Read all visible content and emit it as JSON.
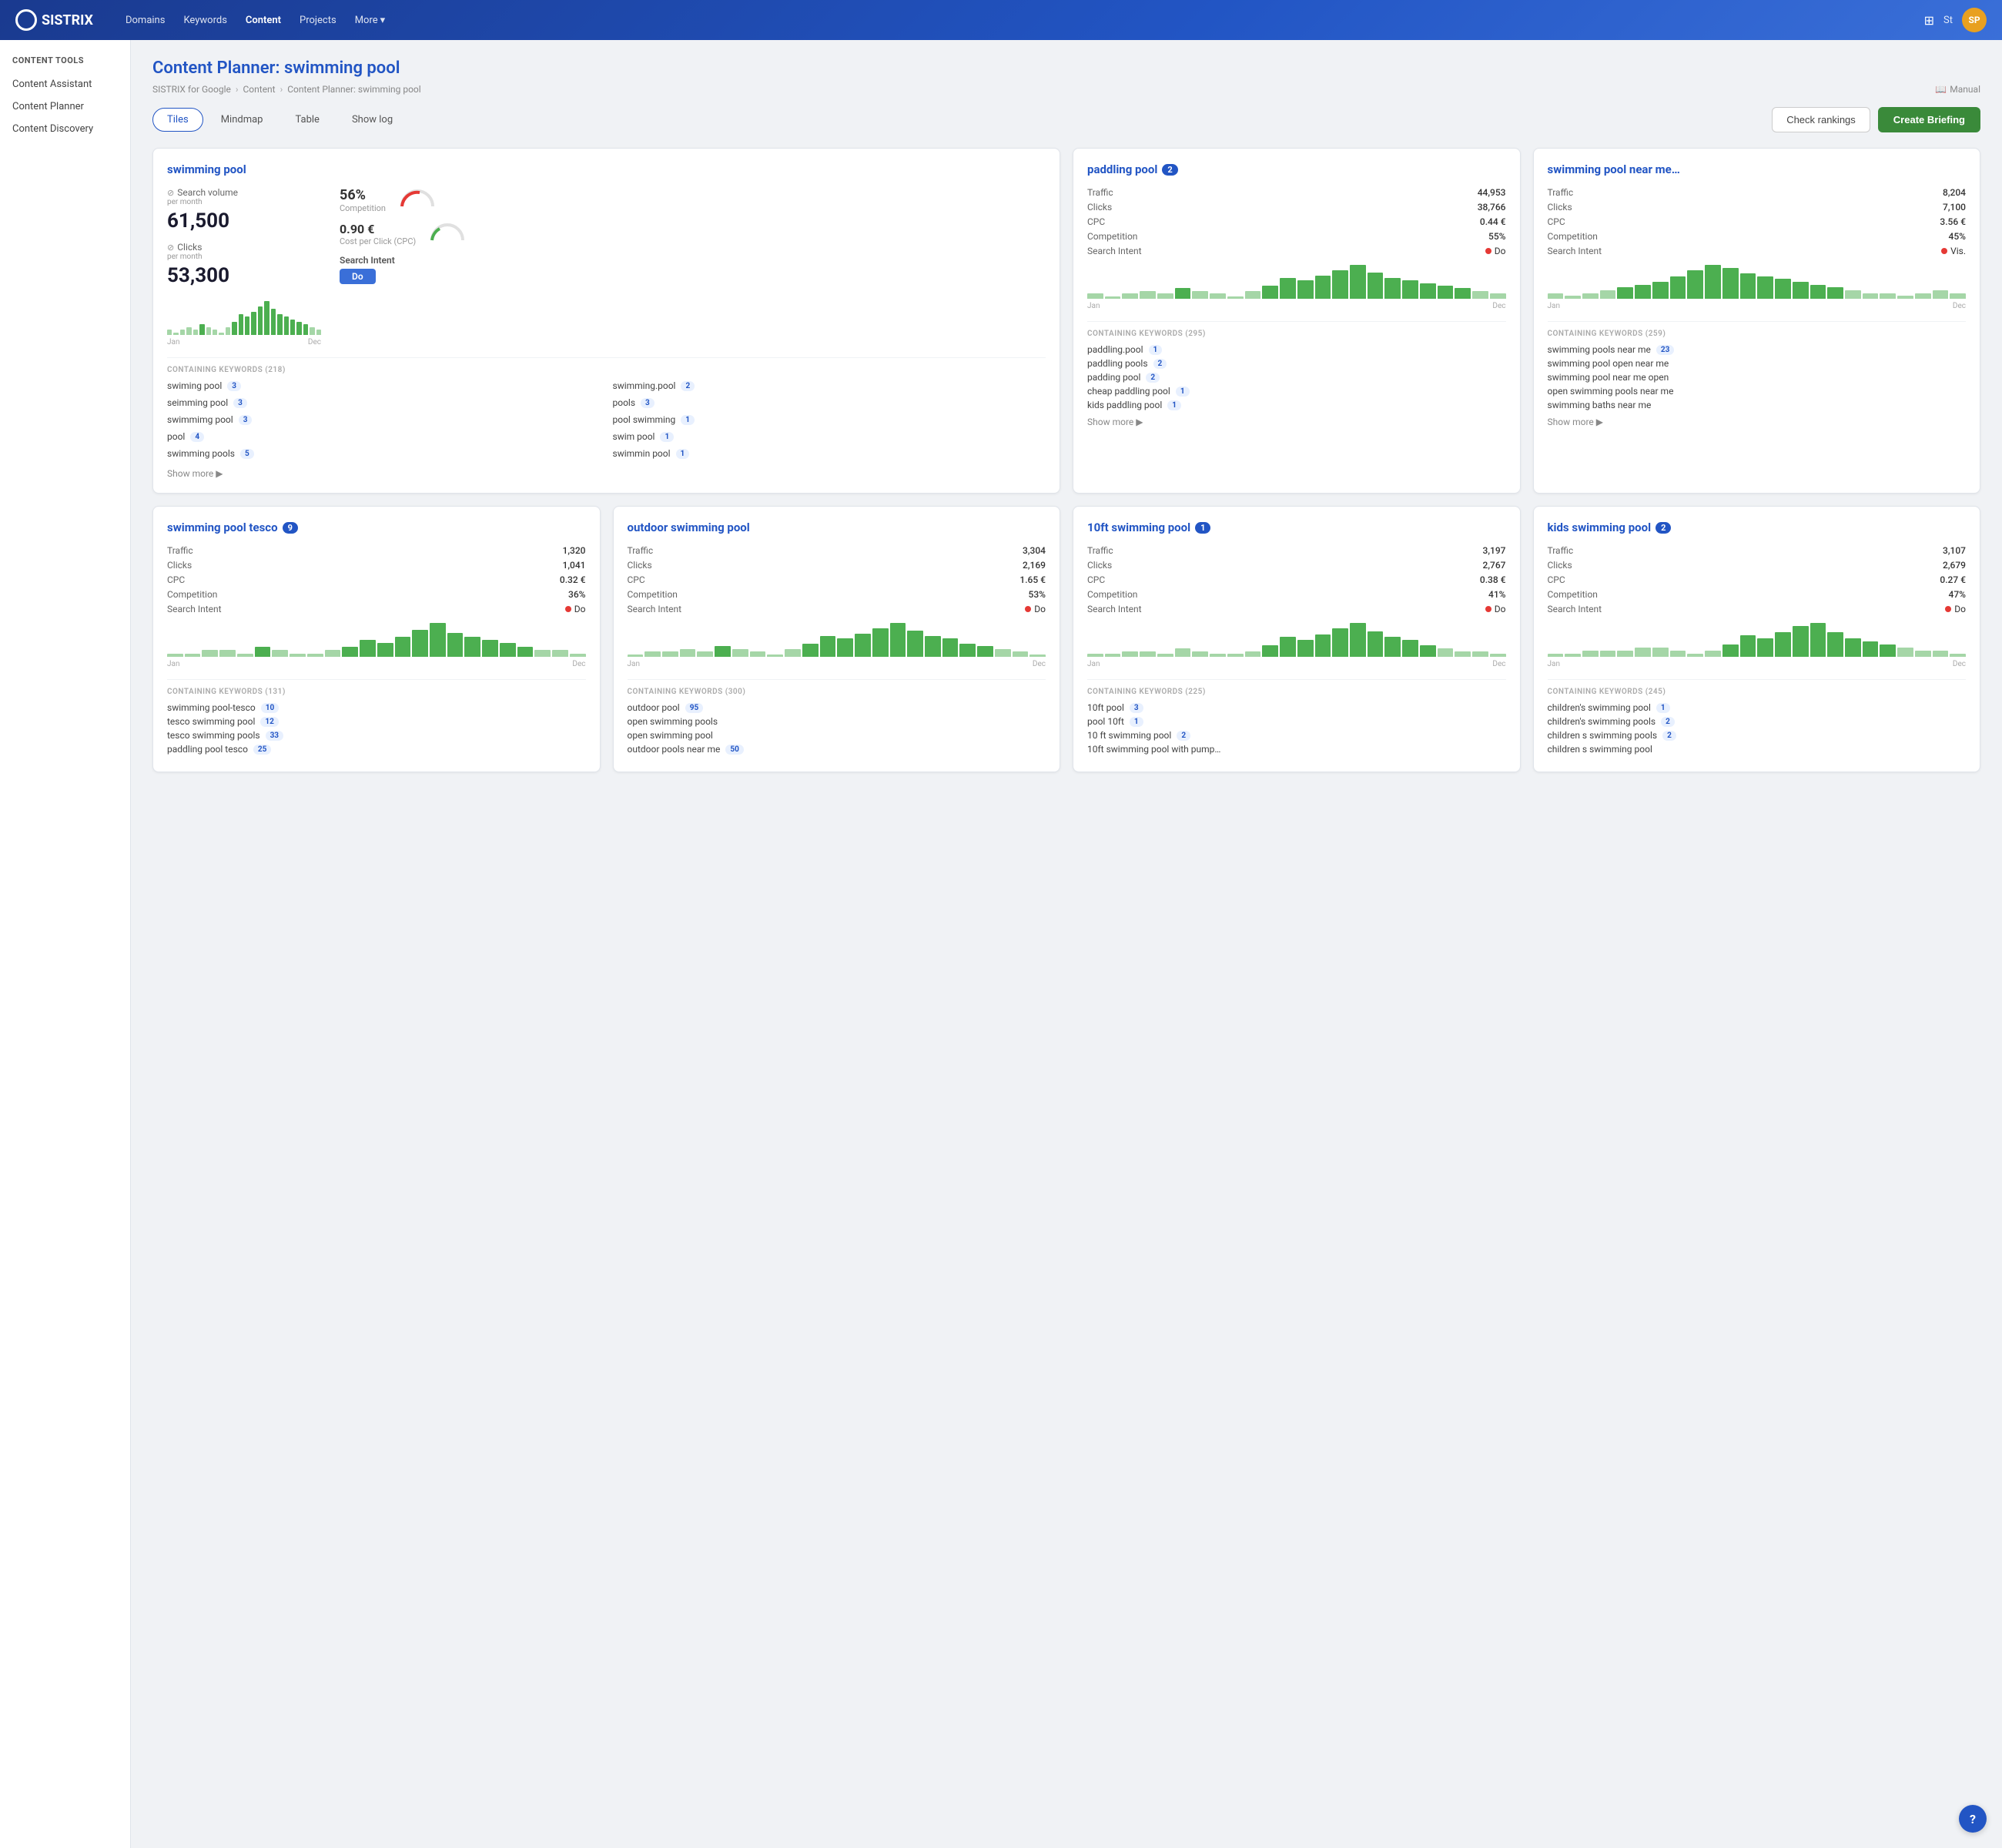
{
  "topnav": {
    "logo": "SISTRIX",
    "links": [
      {
        "label": "Domains",
        "active": false
      },
      {
        "label": "Keywords",
        "active": false
      },
      {
        "label": "Content",
        "active": true
      },
      {
        "label": "Projects",
        "active": false
      },
      {
        "label": "More",
        "active": false,
        "hasArrow": true
      }
    ],
    "user_initial": "St",
    "avatar_initials": "SP"
  },
  "sidebar": {
    "section_title": "CONTENT TOOLS",
    "items": [
      {
        "label": "Content Assistant"
      },
      {
        "label": "Content Planner"
      },
      {
        "label": "Content Discovery"
      }
    ]
  },
  "breadcrumb": {
    "items": [
      "SISTRIX for Google",
      "Content",
      "Content Planner: swimming pool"
    ],
    "manual_label": "Manual",
    "manual_icon": "book-icon"
  },
  "page": {
    "title_prefix": "Content Planner:",
    "title_keyword": "swimming pool"
  },
  "tabs": {
    "items": [
      {
        "label": "Tiles",
        "active": true
      },
      {
        "label": "Mindmap",
        "active": false
      },
      {
        "label": "Table",
        "active": false
      },
      {
        "label": "Show log",
        "active": false
      }
    ],
    "btn_check_rankings": "Check rankings",
    "btn_create_briefing": "Create Briefing"
  },
  "tiles": [
    {
      "id": "swimming-pool-main",
      "title": "swimming pool",
      "badge": null,
      "large": true,
      "search_volume": "61,500",
      "clicks": "53,300",
      "per_month": "per month",
      "competition_pct": "56%",
      "competition_label": "Competition",
      "cpc": "0.90 €",
      "cpc_label": "Cost per Click (CPC)",
      "search_intent_label": "Search Intent",
      "search_intent": "Do",
      "chart_bars": [
        2,
        1,
        2,
        3,
        2,
        4,
        3,
        2,
        1,
        3,
        5,
        8,
        7,
        9,
        11,
        13,
        10,
        8,
        7,
        6,
        5,
        4,
        3,
        2
      ],
      "chart_label_left": "Jan",
      "chart_label_right": "Dec",
      "containing_title": "CONTAINING KEYWORDS (218)",
      "keywords": [
        {
          "text": "swiming pool",
          "count": "3"
        },
        {
          "text": "swimming.pool",
          "count": "2"
        },
        {
          "text": "seimming pool",
          "count": "3"
        },
        {
          "text": "pools",
          "count": "3"
        },
        {
          "text": "swimmimg pool",
          "count": "3"
        },
        {
          "text": "pool swimming",
          "count": "1"
        },
        {
          "text": "pool",
          "count": "4"
        },
        {
          "text": "swim pool",
          "count": "1"
        },
        {
          "text": "swimming pools",
          "count": "5"
        },
        {
          "text": "swimmin pool",
          "count": "1"
        }
      ],
      "show_more": "Show more"
    },
    {
      "id": "paddling-pool",
      "title": "paddling pool",
      "badge": "2",
      "large": false,
      "traffic": "44,953",
      "clicks": "38,766",
      "cpc": "0.44 €",
      "competition": "55%",
      "search_intent": "Do",
      "intent_type": "do",
      "chart_bars": [
        2,
        1,
        2,
        3,
        2,
        4,
        3,
        2,
        1,
        3,
        5,
        8,
        7,
        9,
        11,
        13,
        10,
        8,
        7,
        6,
        5,
        4,
        3,
        2
      ],
      "chart_label_left": "Jan",
      "chart_label_right": "Dec",
      "containing_title": "CONTAINING KEYWORDS (295)",
      "keywords": [
        {
          "text": "paddling.pool",
          "count": "1"
        },
        {
          "text": "paddling pools",
          "count": "2"
        },
        {
          "text": "padding pool",
          "count": "2"
        },
        {
          "text": "cheap paddling pool",
          "count": "1"
        },
        {
          "text": "kids paddling pool",
          "count": "1"
        }
      ],
      "show_more": "Show more"
    },
    {
      "id": "swimming-pool-near-me",
      "title": "swimming pool near me…",
      "badge": null,
      "large": false,
      "traffic": "8,204",
      "clicks": "7,100",
      "cpc": "3.56 €",
      "competition": "45%",
      "search_intent": "Vis.",
      "intent_type": "vis",
      "chart_bars": [
        2,
        1,
        2,
        3,
        4,
        5,
        6,
        8,
        10,
        12,
        11,
        9,
        8,
        7,
        6,
        5,
        4,
        3,
        2,
        2,
        1,
        2,
        3,
        2
      ],
      "chart_label_left": "Jan",
      "chart_label_right": "Dec",
      "containing_title": "CONTAINING KEYWORDS (259)",
      "keywords": [
        {
          "text": "swimming pools near me",
          "count": "23"
        },
        {
          "text": "swimming pool open near me",
          "count": null
        },
        {
          "text": "swimming pool near me open",
          "count": null
        },
        {
          "text": "open swimming pools near me",
          "count": null
        },
        {
          "text": "swimming baths near me",
          "count": null
        }
      ],
      "show_more": "Show more"
    },
    {
      "id": "swimming-pool-tesco",
      "title": "swimming pool tesco",
      "badge": "9",
      "large": false,
      "traffic": "1,320",
      "clicks": "1,041",
      "cpc": "0.32 €",
      "competition": "36%",
      "search_intent": "Do",
      "intent_type": "do",
      "chart_bars": [
        1,
        1,
        2,
        2,
        1,
        3,
        2,
        1,
        1,
        2,
        3,
        5,
        4,
        6,
        8,
        10,
        7,
        6,
        5,
        4,
        3,
        2,
        2,
        1
      ],
      "chart_label_left": "Jan",
      "chart_label_right": "Dec",
      "containing_title": "CONTAINING KEYWORDS (131)",
      "keywords": [
        {
          "text": "swimming pool-tesco",
          "count": "10"
        },
        {
          "text": "tesco swimming pool",
          "count": "12"
        },
        {
          "text": "tesco swimming pools",
          "count": "33"
        },
        {
          "text": "paddling pool tesco",
          "count": "25"
        }
      ],
      "show_more": null
    },
    {
      "id": "outdoor-swimming-pool",
      "title": "outdoor swimming pool",
      "badge": null,
      "large": false,
      "traffic": "3,304",
      "clicks": "2,169",
      "cpc": "1.65 €",
      "competition": "53%",
      "search_intent": "Do",
      "intent_type": "do",
      "chart_bars": [
        1,
        2,
        2,
        3,
        2,
        4,
        3,
        2,
        1,
        3,
        5,
        8,
        7,
        9,
        11,
        13,
        10,
        8,
        7,
        5,
        4,
        3,
        2,
        1
      ],
      "chart_label_left": "Jan",
      "chart_label_right": "Dec",
      "containing_title": "CONTAINING KEYWORDS (300)",
      "keywords": [
        {
          "text": "outdoor pool",
          "count": "95"
        },
        {
          "text": "open swimming pools",
          "count": null
        },
        {
          "text": "open swimming pool",
          "count": null
        },
        {
          "text": "outdoor pools near me",
          "count": "50"
        }
      ],
      "show_more": null
    },
    {
      "id": "10ft-swimming-pool",
      "title": "10ft swimming pool",
      "badge": "1",
      "large": false,
      "traffic": "3,197",
      "clicks": "2,767",
      "cpc": "0.38 €",
      "competition": "41%",
      "search_intent": "Do",
      "intent_type": "do",
      "chart_bars": [
        1,
        1,
        2,
        2,
        1,
        3,
        2,
        1,
        1,
        2,
        4,
        7,
        6,
        8,
        10,
        12,
        9,
        7,
        6,
        4,
        3,
        2,
        2,
        1
      ],
      "chart_label_left": "Jan",
      "chart_label_right": "Dec",
      "containing_title": "CONTAINING KEYWORDS (225)",
      "keywords": [
        {
          "text": "10ft pool",
          "count": "3"
        },
        {
          "text": "pool 10ft",
          "count": "1"
        },
        {
          "text": "10 ft swimming pool",
          "count": "2"
        },
        {
          "text": "10ft swimming pool with pump…",
          "count": null
        }
      ],
      "show_more": null
    },
    {
      "id": "kids-swimming-pool",
      "title": "kids swimming pool",
      "badge": "2",
      "large": false,
      "traffic": "3,107",
      "clicks": "2,679",
      "cpc": "0.27 €",
      "competition": "47%",
      "search_intent": "Do",
      "intent_type": "do",
      "chart_bars": [
        1,
        1,
        2,
        2,
        2,
        3,
        3,
        2,
        1,
        2,
        4,
        7,
        6,
        8,
        10,
        11,
        8,
        6,
        5,
        4,
        3,
        2,
        2,
        1
      ],
      "chart_label_left": "Jan",
      "chart_label_right": "Dec",
      "containing_title": "CONTAINING KEYWORDS (245)",
      "keywords": [
        {
          "text": "children's swimming pool",
          "count": "1"
        },
        {
          "text": "children's swimming pools",
          "count": "2"
        },
        {
          "text": "children s swimming pools",
          "count": "2"
        },
        {
          "text": "children s swimming pool",
          "count": null
        }
      ],
      "show_more": null
    }
  ],
  "help": {
    "label": "?"
  }
}
